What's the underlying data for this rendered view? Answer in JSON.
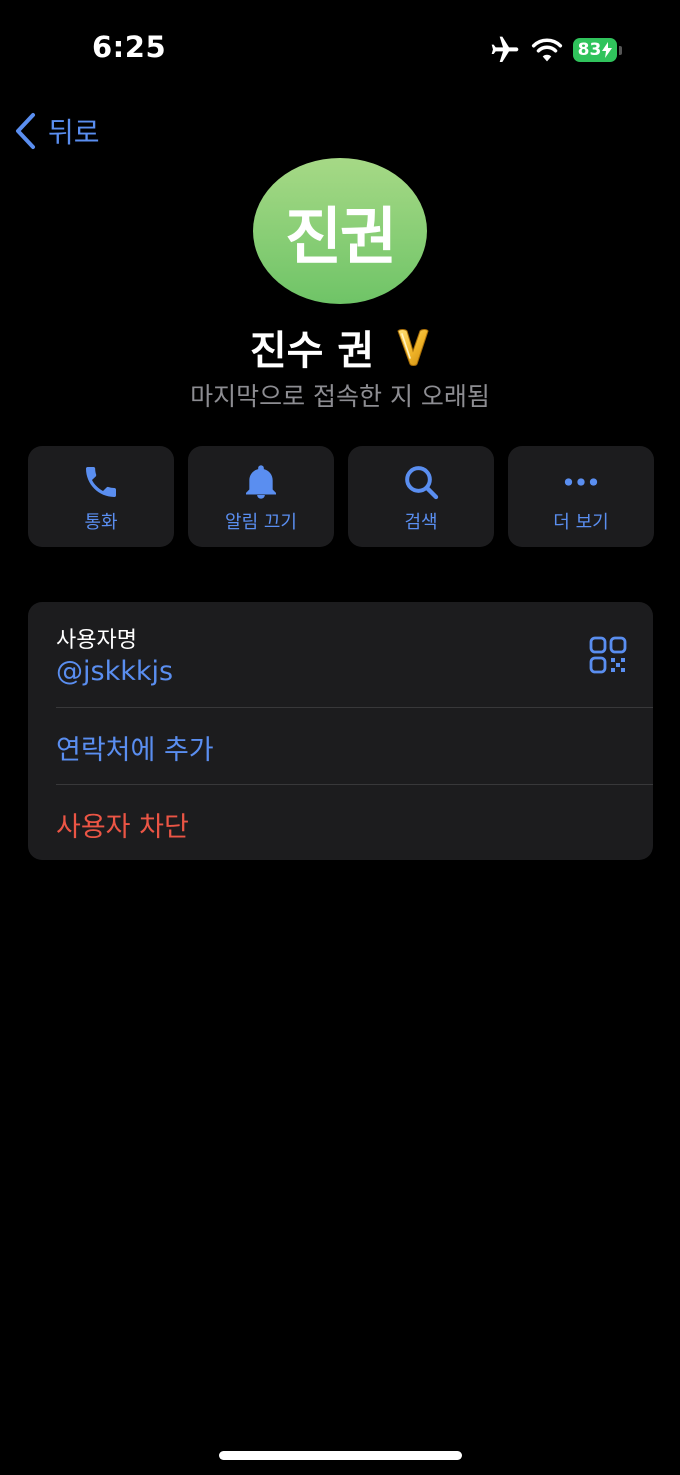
{
  "status_bar": {
    "time": "6:25",
    "battery_level": "83",
    "battery_color": "#30c35c",
    "icons": [
      "airplane-icon",
      "wifi-icon",
      "battery-charging-icon"
    ]
  },
  "nav": {
    "back_label": "뒤로",
    "back_icon": "chevron-left-icon"
  },
  "profile": {
    "avatar_initials": "진권",
    "name": "진수 권",
    "badge_icon": "premium-badge-icon",
    "last_seen": "마지막으로 접속한 지 오래됨"
  },
  "actions": [
    {
      "icon": "phone-icon",
      "label": "통화"
    },
    {
      "icon": "bell-icon",
      "label": "알림 끄기"
    },
    {
      "icon": "search-icon",
      "label": "검색"
    },
    {
      "icon": "more-icon",
      "label": "더 보기"
    }
  ],
  "info": {
    "username_label": "사용자명",
    "username_value": "@jskkkjs",
    "qr_icon": "qr-code-icon",
    "add_contact": "연락처에 추가",
    "block_user": "사용자 차단"
  },
  "colors": {
    "accent": "#5a8ef0",
    "destructive": "#eb5545",
    "card_background": "#1c1c1e",
    "avatar_gradient": [
      "#a6d986",
      "#6fc467"
    ]
  }
}
